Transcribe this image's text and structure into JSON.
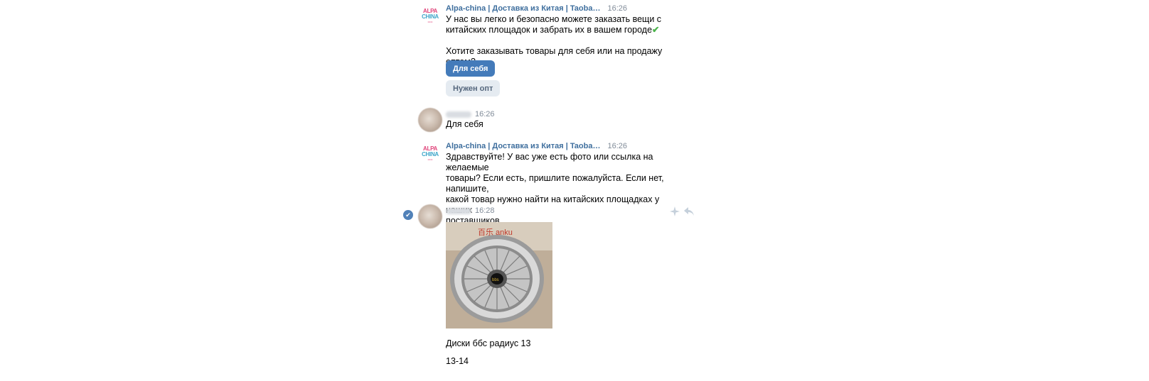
{
  "messages": {
    "m1": {
      "author": "Alpa-china | Доставка из Китая | Taoba…",
      "time": "16:26",
      "text_line1": "У нас вы легко и безопасно можете заказать вещи с",
      "text_line2": "китайских площадок и забрать их в вашем городе",
      "check": "✔",
      "text_line3": "Хотите заказывать товары для себя или на продажу оптом?",
      "button_primary": "Для себя",
      "button_secondary": "Нужен опт"
    },
    "m2": {
      "time": "16:26",
      "text": "Для себя"
    },
    "m3": {
      "author": "Alpa-china | Доставка из Китая | Taoba…",
      "time": "16:26",
      "line1": "Здравствуйте! У вас уже есть фото или ссылка на желаемые",
      "line2": "товары? Если есть, пришлите пожалуйста. Если нет, напишите,",
      "line3": "какой товар нужно найти на китайских площадках у наших",
      "line4": "поставщиков"
    },
    "m4": {
      "time": "16:28",
      "caption1": "Диски ббс радиус 13",
      "caption2": "13-14"
    }
  },
  "brand_logo": {
    "line1": "ALPA",
    "line2": "CHINA"
  },
  "icons": [
    "brand-avatar-icon",
    "read-check-icon",
    "sparkle-icon",
    "reply-icon"
  ],
  "colors": {
    "accent": "#447bba",
    "author": "#3f6f9e",
    "time": "#818c99",
    "check": "#4bb34b"
  }
}
